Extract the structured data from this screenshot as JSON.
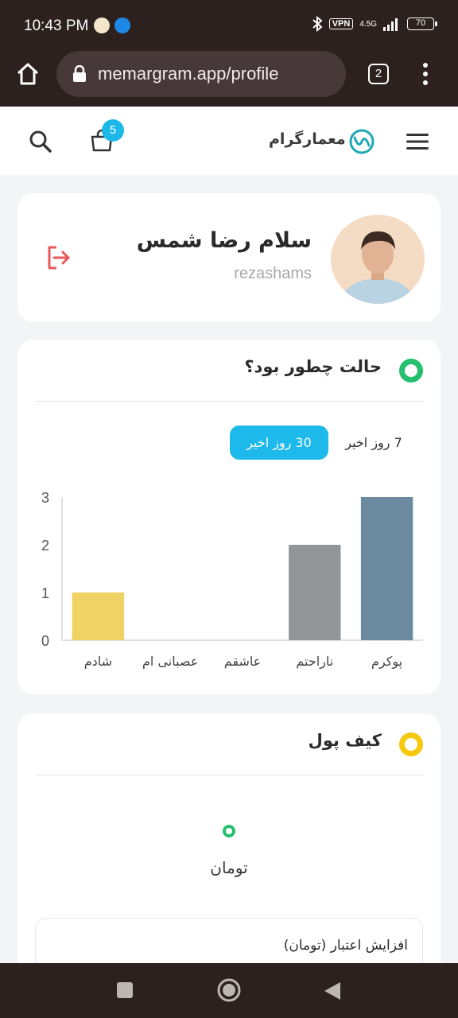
{
  "status_bar": {
    "time": "10:43 PM",
    "network": "4.5G",
    "vpn": "VPN",
    "battery": "70"
  },
  "browser": {
    "url": "memargram.app/profile",
    "tab_count": "2"
  },
  "header": {
    "logo_text": "معمارگرام",
    "cart_count": "5"
  },
  "profile": {
    "greeting_name": "سلام رضا شمس",
    "username": "rezashams"
  },
  "mood": {
    "title": "حالت چطور بود؟",
    "accent": "#24c06f",
    "tabs": [
      {
        "label": "30 روز اخیر",
        "active": true
      },
      {
        "label": "7 روز اخیر",
        "active": false
      }
    ]
  },
  "chart_data": {
    "type": "bar",
    "categories": [
      "پوکرم",
      "ناراحتم",
      "عاشقم",
      "عصبانی ام",
      "شادم"
    ],
    "values": [
      3,
      2,
      0,
      0,
      1
    ],
    "colors": [
      "#6b8aa0",
      "#939699",
      "#e06b6b",
      "#d9534f",
      "#f0d264"
    ],
    "title": "",
    "xlabel": "",
    "ylabel": "",
    "ylim": [
      0,
      3
    ],
    "yticks": [
      "0",
      "1",
      "2",
      "3"
    ],
    "grid": false
  },
  "wallet": {
    "title": "کیف پول",
    "accent": "#f6c90e",
    "currency": "تومان",
    "credit_label": "افزایش اعتبار (تومان)"
  }
}
